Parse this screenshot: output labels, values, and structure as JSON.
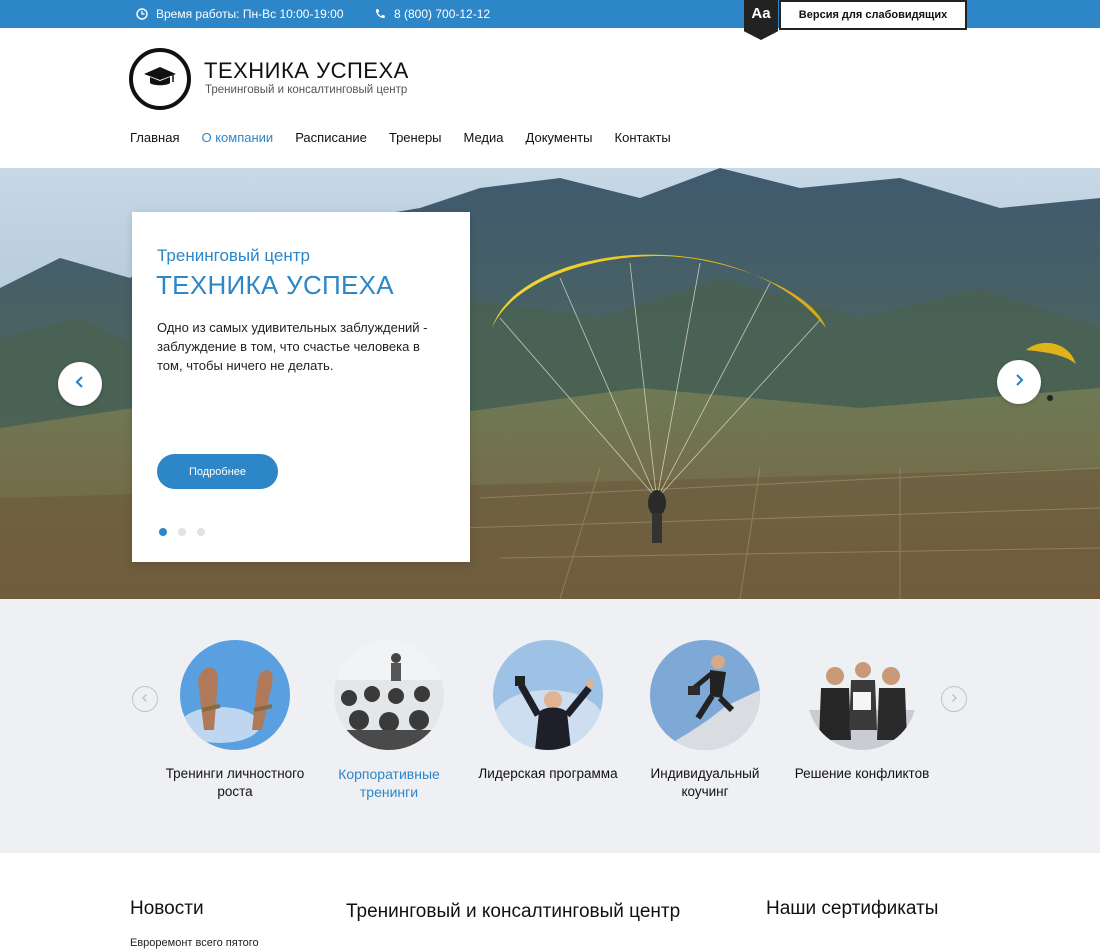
{
  "topbar": {
    "work_hours": "Время работы: Пн-Вс 10:00-19:00",
    "phone": "8 (800) 700-12-12",
    "a11y_badge": "Aa",
    "a11y_label": "Версия для слабовидящих",
    "color": "#2d86c8"
  },
  "brand": {
    "title": "ТЕХНИКА УСПЕХА",
    "subtitle": "Тренинговый и консалтинговый центр",
    "logo_icon": "graduation-cap-icon"
  },
  "nav": {
    "items": [
      "Главная",
      "О компании",
      "Расписание",
      "Тренеры",
      "Медиа",
      "Документы",
      "Контакты"
    ],
    "active": "О компании"
  },
  "hero": {
    "kicker": "Тренинговый центр",
    "title": "ТЕХНИКА УСПЕХА",
    "text": "Одно из самых удивительных заблуждений - заблуждение в том, что счастье человека в том, чтобы ничего не делать.",
    "button": "Подробнее",
    "slides_total": 3,
    "active_slide": 1
  },
  "services": {
    "items": [
      {
        "label": "Тренинги личностного роста"
      },
      {
        "label": "Корпоративные тренинги"
      },
      {
        "label": "Лидерская программа"
      },
      {
        "label": "Индивидуальный коучинг"
      },
      {
        "label": "Решение конфликтов"
      }
    ],
    "active_index": 1
  },
  "bottom": {
    "news_title": "Новости",
    "news_teaser": "Евроремонт всего пятого",
    "center_title": "Тренинговый и консалтинговый центр",
    "certs_title": "Наши сертификаты"
  },
  "colors": {
    "accent": "#2d86c8",
    "services_bg": "#eef0f3"
  }
}
